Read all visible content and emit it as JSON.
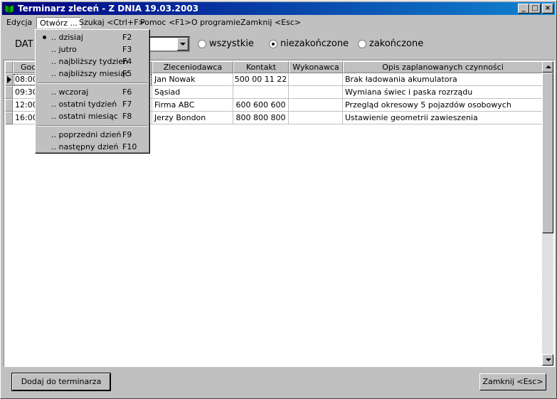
{
  "window": {
    "title": "Terminarz zleceń - Z DNIA 19.03.2003",
    "minimize": "_",
    "maximize": "□",
    "close": "×"
  },
  "menu": {
    "items": [
      "Edycja",
      "Otwórz ...",
      "Szukaj <Ctrl+F>",
      "Pomoc <F1>",
      "O programie",
      "Zamknij <Esc>"
    ]
  },
  "toolbar": {
    "date_label": "DAT",
    "filter_options": [
      {
        "label": "wszystkie",
        "selected": false
      },
      {
        "label": "niezakończone",
        "selected": true
      },
      {
        "label": "zakończone",
        "selected": false
      }
    ]
  },
  "dropdown": {
    "items": [
      {
        "label": ".. dzisiaj",
        "key": "F2",
        "checked": true
      },
      {
        "label": ".. jutro",
        "key": "F3"
      },
      {
        "label": ".. najbliższy tydzień",
        "key": "F4"
      },
      {
        "label": ".. najbliższy miesiąc",
        "key": "F5"
      },
      {
        "label": ".. wczoraj",
        "key": "F6"
      },
      {
        "label": ".. ostatni tydzień",
        "key": "F7"
      },
      {
        "label": ".. ostatni miesiąc",
        "key": "F8"
      },
      {
        "label": ".. poprzedni dzień",
        "key": "F9"
      },
      {
        "label": ".. następny dzień",
        "key": "F10"
      }
    ]
  },
  "table": {
    "columns": [
      "God",
      "Zleceniodawca",
      "Kontakt",
      "Wykonawca",
      "Opis zaplanowanych czynności"
    ],
    "rows": [
      {
        "time": "08:00",
        "client": "Jan Nowak",
        "contact": "500 00 11 22",
        "executor": "",
        "desc": "Brak ładowania akumulatora"
      },
      {
        "time": "09:30",
        "client": "Sąsiad",
        "contact": "",
        "executor": "",
        "desc": "Wymiana świec i paska rozrządu"
      },
      {
        "time": "12:00",
        "client": "Firma ABC",
        "contact": "600 600 600",
        "executor": "",
        "desc": "Przegląd okresowy 5 pojazdów osobowych"
      },
      {
        "time": "16:00",
        "client": "Jerzy Bondon",
        "contact": "800 800 800",
        "executor": "",
        "desc": "Ustawienie geometrii zawieszenia"
      }
    ]
  },
  "footer": {
    "add_button": "Dodaj do terminarza",
    "close_button": "Zamknij <Esc>"
  },
  "colors": {
    "titlebar_start": "#000080",
    "titlebar_end": "#1084d0",
    "face": "#c0c0c0"
  }
}
